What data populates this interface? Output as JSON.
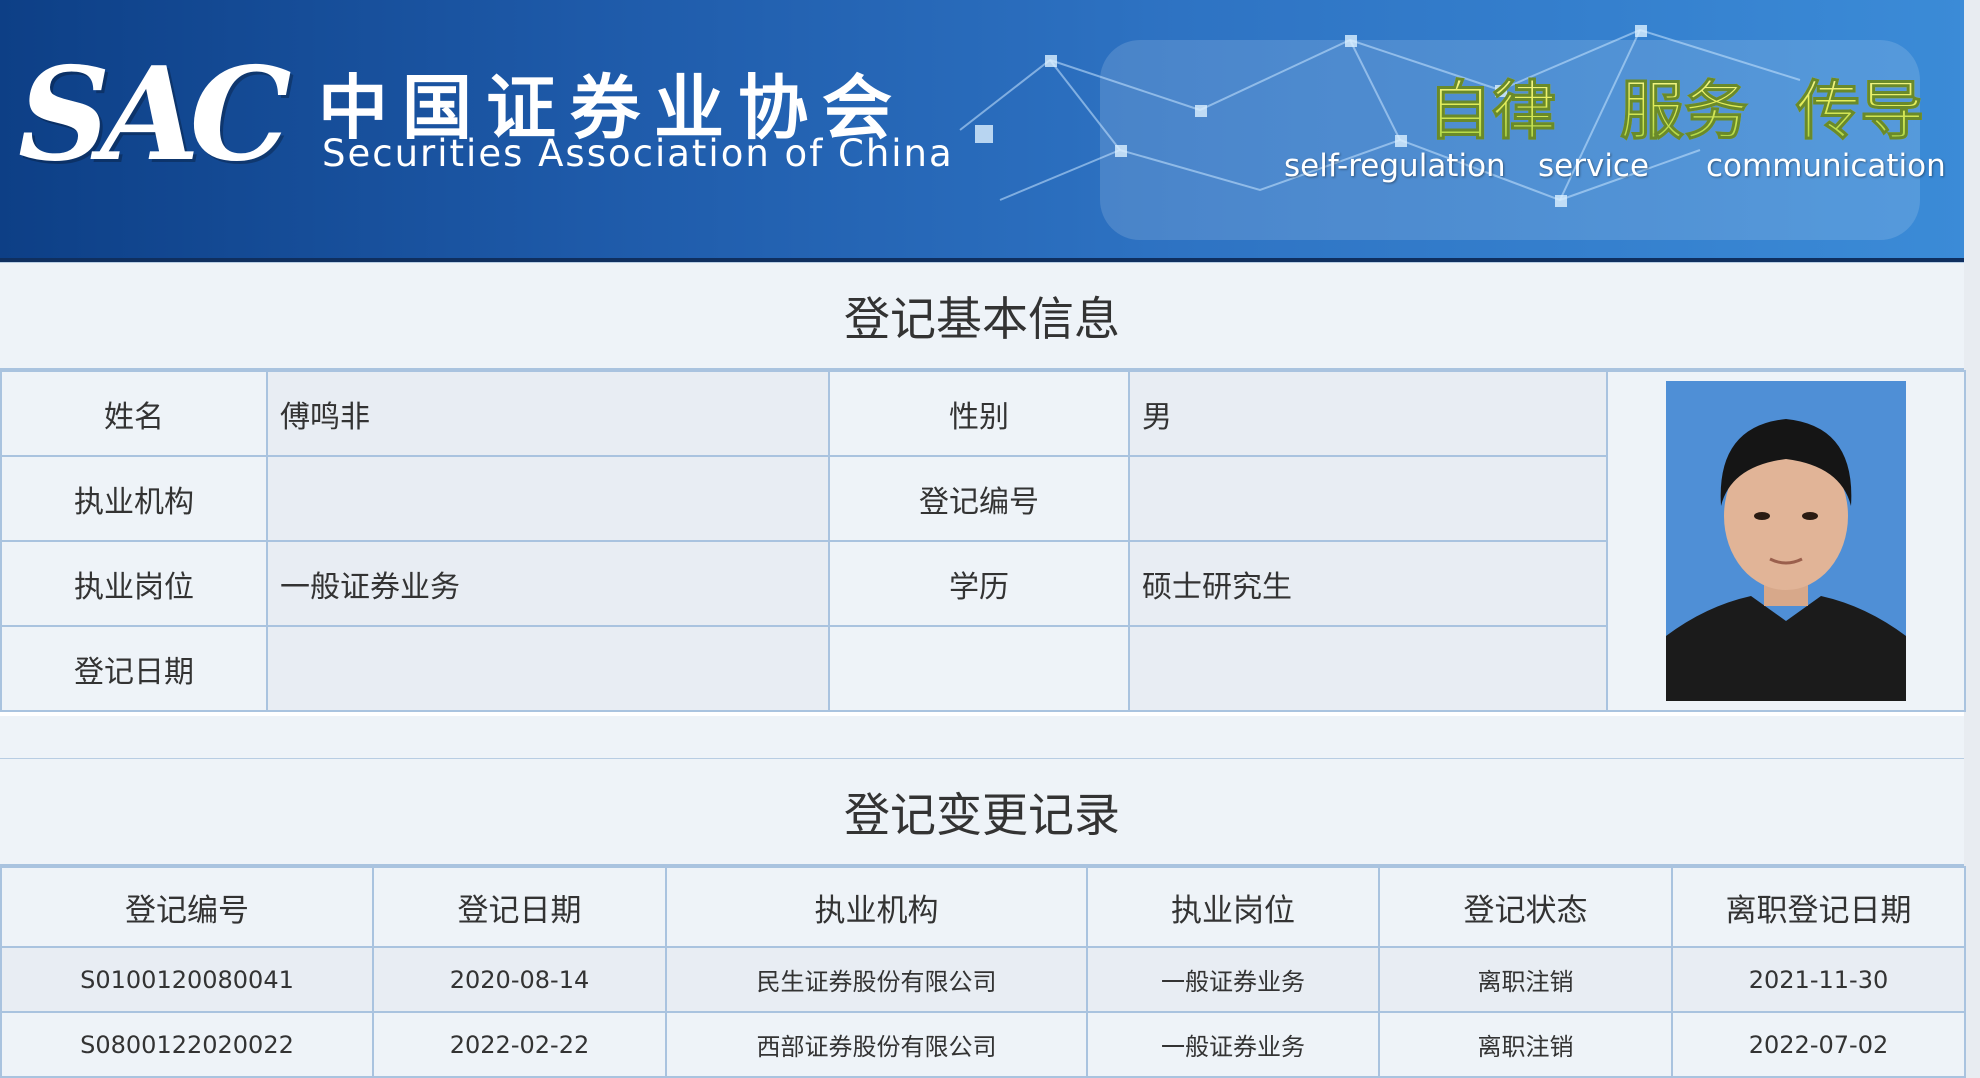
{
  "banner": {
    "logo_sac": "SAC",
    "logo_cn": "中国证券业协会",
    "logo_en": "Securities Association of China",
    "slogans": [
      {
        "cn": "自律",
        "en": "self-regulation"
      },
      {
        "cn": "服务",
        "en": "service"
      },
      {
        "cn": "传导",
        "en": "communication"
      }
    ]
  },
  "basic_info": {
    "title": "登记基本信息",
    "name_label": "姓名",
    "name_value": "傅鸣非",
    "gender_label": "性别",
    "gender_value": "男",
    "org_label": "执业机构",
    "org_value": "",
    "reg_no_label": "登记编号",
    "reg_no_value": "",
    "position_label": "执业岗位",
    "position_value": "一般证券业务",
    "education_label": "学历",
    "education_value": "硕士研究生",
    "reg_date_label": "登记日期",
    "reg_date_value": ""
  },
  "change_records": {
    "title": "登记变更记录",
    "headers": [
      "登记编号",
      "登记日期",
      "执业机构",
      "执业岗位",
      "登记状态",
      "离职登记日期"
    ],
    "rows": [
      [
        "S0100120080041",
        "2020-08-14",
        "民生证券股份有限公司",
        "一般证券业务",
        "离职注销",
        "2021-11-30"
      ],
      [
        "S0800122020022",
        "2022-02-22",
        "西部证券股份有限公司",
        "一般证券业务",
        "离职注销",
        "2022-07-02"
      ]
    ]
  },
  "colors": {
    "banner_dark": "#0d3f86",
    "banner_light": "#3b8bd7",
    "border": "#a9c3df",
    "photo_bg": "#4f8fd6"
  }
}
